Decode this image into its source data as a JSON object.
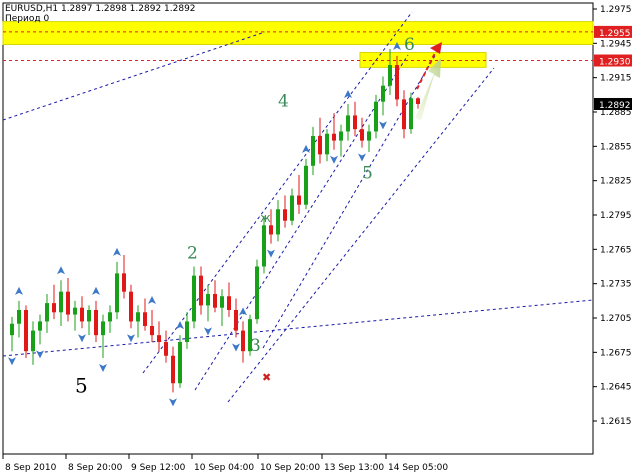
{
  "chart_data": {
    "type": "candlestick",
    "header": {
      "symbol_line": "EURUSD,H1 1.2897 1.2898 1.2892 1.2892",
      "indicator_line": "Период 0"
    },
    "y_ticks": [
      "1.2975",
      "1.2945",
      "1.2915",
      "1.2885",
      "1.2855",
      "1.2825",
      "1.2795",
      "1.2765",
      "1.2735",
      "1.2705",
      "1.2675",
      "1.2645",
      "1.2615"
    ],
    "x_ticks": [
      "8 Sep 2010",
      "8 Sep 20:00",
      "9 Sep 12:00",
      "10 Sep 04:00",
      "10 Sep 20:00",
      "13 Sep 13:00",
      "14 Sep 05:00"
    ],
    "price_labels": [
      {
        "value": 1.2955,
        "label": "1.2955",
        "style": "red"
      },
      {
        "value": 1.293,
        "label": "1.2930",
        "style": "red"
      },
      {
        "value": 1.2892,
        "label": "1.2892",
        "style": "black"
      }
    ],
    "zones": [
      {
        "from": 1.2944,
        "to": 1.2964
      },
      {
        "from": 1.2924,
        "to": 1.2937
      }
    ],
    "wave_labels": [
      {
        "text": "2",
        "bar": 25,
        "price": 1.2757,
        "color": "#3a8a58",
        "size": 17
      },
      {
        "text": "3",
        "bar": 34,
        "price": 1.2676,
        "color": "#3a8a58",
        "size": 17
      },
      {
        "text": "4",
        "bar": 38,
        "price": 1.289,
        "color": "#3a8a58",
        "size": 17
      },
      {
        "text": "5",
        "bar": 50,
        "price": 1.2827,
        "color": "#3a8a58",
        "size": 17
      },
      {
        "text": "6",
        "bar": 56,
        "price": 1.2939,
        "color": "#3a8a58",
        "size": 17
      },
      {
        "text": "5",
        "bar": 9,
        "price": 1.264,
        "color": "#000000",
        "size": 20
      }
    ],
    "candles": [
      [
        1.269,
        1.2706,
        1.2676,
        1.27
      ],
      [
        1.27,
        1.272,
        1.2688,
        1.2712
      ],
      [
        1.2712,
        1.2716,
        1.267,
        1.2676
      ],
      [
        1.2676,
        1.2702,
        1.2664,
        1.2694
      ],
      [
        1.2694,
        1.2708,
        1.2682,
        1.2702
      ],
      [
        1.2702,
        1.2726,
        1.2692,
        1.2718
      ],
      [
        1.2718,
        1.2734,
        1.2704,
        1.271
      ],
      [
        1.271,
        1.2738,
        1.2698,
        1.2728
      ],
      [
        1.2728,
        1.274,
        1.2702,
        1.2708
      ],
      [
        1.2708,
        1.272,
        1.2694,
        1.2714
      ],
      [
        1.2714,
        1.2724,
        1.2696,
        1.2702
      ],
      [
        1.2702,
        1.2716,
        1.269,
        1.2712
      ],
      [
        1.2712,
        1.272,
        1.2684,
        1.269
      ],
      [
        1.269,
        1.2708,
        1.267,
        1.2702
      ],
      [
        1.2702,
        1.2716,
        1.2692,
        1.271
      ],
      [
        1.271,
        1.2754,
        1.2704,
        1.2744
      ],
      [
        1.2744,
        1.276,
        1.2722,
        1.2728
      ],
      [
        1.2728,
        1.2734,
        1.2696,
        1.2702
      ],
      [
        1.2702,
        1.2716,
        1.2688,
        1.271
      ],
      [
        1.271,
        1.2722,
        1.2694,
        1.2698
      ],
      [
        1.2698,
        1.2712,
        1.2684,
        1.269
      ],
      [
        1.269,
        1.2702,
        1.2676,
        1.2684
      ],
      [
        1.2684,
        1.2694,
        1.2666,
        1.2672
      ],
      [
        1.2672,
        1.268,
        1.264,
        1.2648
      ],
      [
        1.2648,
        1.269,
        1.2644,
        1.2684
      ],
      [
        1.2684,
        1.271,
        1.2678,
        1.2702
      ],
      [
        1.2702,
        1.275,
        1.2696,
        1.2742
      ],
      [
        1.2742,
        1.275,
        1.2708,
        1.2716
      ],
      [
        1.2716,
        1.2734,
        1.2702,
        1.2726
      ],
      [
        1.2726,
        1.2738,
        1.271,
        1.2714
      ],
      [
        1.2714,
        1.273,
        1.2698,
        1.2724
      ],
      [
        1.2724,
        1.2736,
        1.2706,
        1.2712
      ],
      [
        1.2712,
        1.2722,
        1.2688,
        1.2694
      ],
      [
        1.2694,
        1.2702,
        1.2666,
        1.2676
      ],
      [
        1.2676,
        1.2708,
        1.2672,
        1.2704
      ],
      [
        1.2704,
        1.2756,
        1.27,
        1.275
      ],
      [
        1.275,
        1.2794,
        1.2744,
        1.2786
      ],
      [
        1.2786,
        1.28,
        1.277,
        1.2778
      ],
      [
        1.2778,
        1.2808,
        1.2772,
        1.28
      ],
      [
        1.28,
        1.2812,
        1.2784,
        1.279
      ],
      [
        1.279,
        1.2818,
        1.2786,
        1.2812
      ],
      [
        1.2812,
        1.283,
        1.2796,
        1.2804
      ],
      [
        1.2804,
        1.2844,
        1.28,
        1.2838
      ],
      [
        1.2838,
        1.2872,
        1.283,
        1.2864
      ],
      [
        1.2864,
        1.288,
        1.284,
        1.2848
      ],
      [
        1.2848,
        1.287,
        1.2842,
        1.2866
      ],
      [
        1.2866,
        1.2884,
        1.2852,
        1.286
      ],
      [
        1.286,
        1.2874,
        1.2846,
        1.2868
      ],
      [
        1.2868,
        1.2892,
        1.286,
        1.2882
      ],
      [
        1.2882,
        1.2894,
        1.2864,
        1.287
      ],
      [
        1.287,
        1.288,
        1.2854,
        1.286
      ],
      [
        1.286,
        1.2874,
        1.285,
        1.2868
      ],
      [
        1.2868,
        1.29,
        1.2862,
        1.2894
      ],
      [
        1.2894,
        1.2916,
        1.2882,
        1.2908
      ],
      [
        1.2908,
        1.294,
        1.29,
        1.2926
      ],
      [
        1.2926,
        1.2934,
        1.289,
        1.2896
      ],
      [
        1.2896,
        1.2904,
        1.2862,
        1.287
      ],
      [
        1.287,
        1.2902,
        1.2866,
        1.2897
      ],
      [
        1.2897,
        1.2898,
        1.2888,
        1.2892
      ]
    ]
  }
}
